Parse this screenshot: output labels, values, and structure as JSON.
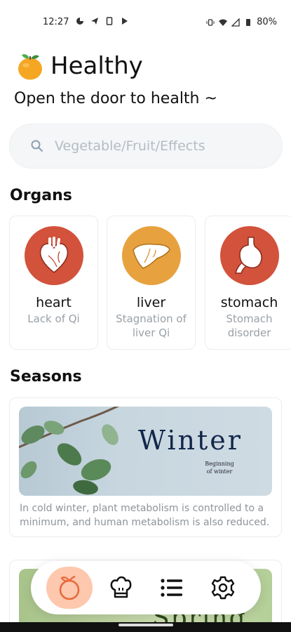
{
  "status_bar": {
    "time": "12:27",
    "battery": "80%"
  },
  "header": {
    "app_title": "Healthy",
    "tagline": "Open the door to health ~"
  },
  "search": {
    "placeholder": "Vegetable/Fruit/Effects"
  },
  "organs": {
    "title": "Organs",
    "items": [
      {
        "name": "heart",
        "desc": "Lack of Qi",
        "icon": "heart-icon",
        "color": "#d2523b"
      },
      {
        "name": "liver",
        "desc": "Stagnation of liver Qi",
        "icon": "liver-icon",
        "color": "#e7a23f"
      },
      {
        "name": "stomach",
        "desc": "Stomach disorder",
        "icon": "stomach-icon",
        "color": "#d2523b"
      }
    ]
  },
  "seasons": {
    "title": "Seasons",
    "items": [
      {
        "banner_title": "Winter",
        "banner_subtitle": "Beginning of winter",
        "desc": "In cold winter, plant metabolism is controlled to a minimum, and human metabolism is also reduced."
      },
      {
        "banner_title": "Spring"
      }
    ]
  },
  "bottom_nav": {
    "items": [
      {
        "icon": "orange-icon",
        "active": true
      },
      {
        "icon": "chef-hat-icon",
        "active": false
      },
      {
        "icon": "list-icon",
        "active": false
      },
      {
        "icon": "settings-icon",
        "active": false
      }
    ]
  },
  "colors": {
    "accent": "#fdc8ae",
    "organ_red": "#d2523b",
    "organ_orange": "#e7a23f"
  }
}
